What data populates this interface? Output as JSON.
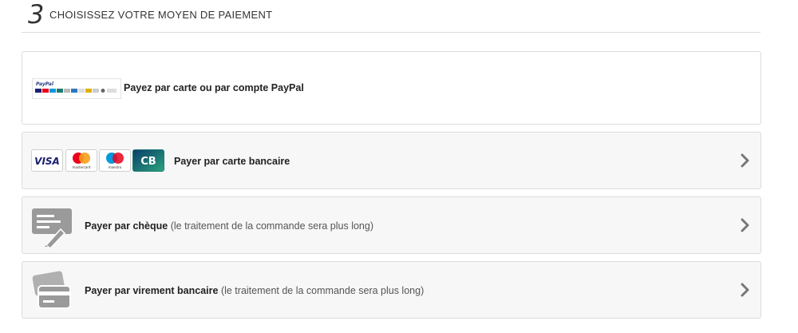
{
  "step": {
    "number": "3",
    "title": "CHOISISSEZ VOTRE MOYEN DE PAIEMENT"
  },
  "options": [
    {
      "label": "Payez par carte ou par compte PayPal",
      "sub": "",
      "icon": "paypal-logo",
      "chevron": false
    },
    {
      "label": "Payer par carte bancaire",
      "sub": "",
      "icon": "card-logos",
      "chevron": true
    },
    {
      "label": "Payer par chèque",
      "sub": "(le traitement de la commande sera plus long)",
      "icon": "cheque-icon",
      "chevron": true
    },
    {
      "label": "Payer par virement bancaire",
      "sub": "(le traitement de la commande sera plus long)",
      "icon": "bank-transfer-icon",
      "chevron": true
    }
  ],
  "logos": {
    "paypal": "PayPal",
    "visa": "VISA",
    "mastercard": "mastercard",
    "maestro": "maestro",
    "cb": "CB"
  },
  "colors": {
    "border": "#dcdcdc",
    "panel": "#f7f7f7",
    "icon_gray": "#9a9a9a",
    "chevron": "#777777",
    "cb_green": "#1f7a74"
  }
}
